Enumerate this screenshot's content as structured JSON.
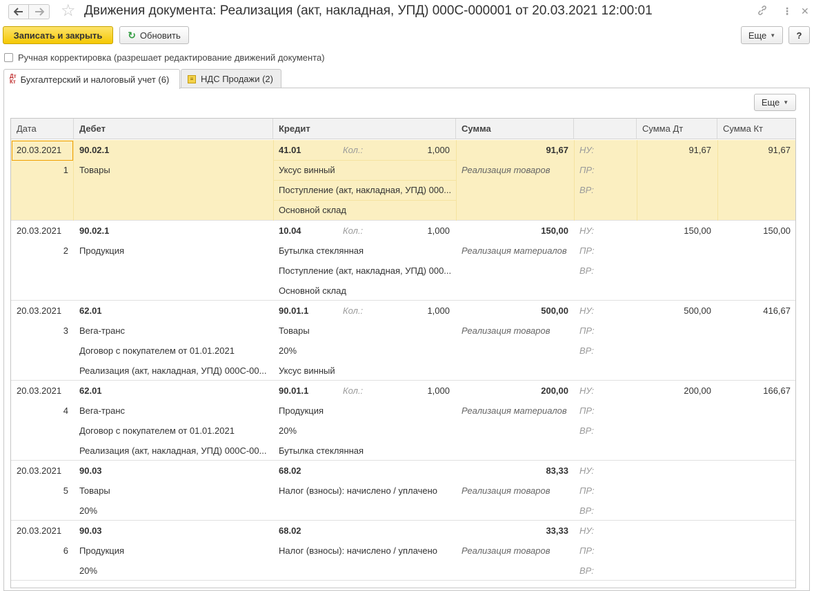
{
  "window": {
    "title": "Движения документа: Реализация (акт, накладная, УПД) 000С-000001 от 20.03.2021 12:00:01",
    "icons": {
      "back": "arrow-left-icon",
      "forward": "arrow-right-icon",
      "favorite": "star-icon",
      "link": "link-icon",
      "menu": "kebab-icon",
      "close": "close-icon"
    }
  },
  "toolbar": {
    "save_close_label": "Записать и закрыть",
    "refresh_label": "Обновить",
    "more_label": "Еще",
    "help_label": "?"
  },
  "manual_correction": {
    "label": "Ручная корректировка (разрешает редактирование движений документа)",
    "checked": false
  },
  "tabs": [
    {
      "label": "Бухгалтерский и налоговый учет (6)",
      "icon": "dt-kt-icon",
      "active": true
    },
    {
      "label": "НДС Продажи (2)",
      "icon": "register-icon",
      "active": false
    }
  ],
  "panel": {
    "more_label": "Еще"
  },
  "table": {
    "columns": [
      "Дата",
      "Дебет",
      "Кредит",
      "Сумма",
      "",
      "Сумма Дт",
      "Сумма Кт"
    ],
    "qty_label": "Кол.:",
    "tax_labels": [
      "НУ:",
      "ПР:",
      "ВР:"
    ],
    "rows": [
      {
        "date": "20.03.2021",
        "num": "1",
        "debit": [
          "90.02.1",
          "Товары",
          "",
          ""
        ],
        "credit": [
          "41.01",
          "Уксус винный",
          "Поступление (акт, накладная, УПД) 000...",
          "Основной склад"
        ],
        "qty": "1,000",
        "sum": "91,67",
        "content": "Реализация товаров",
        "sum_dt": "91,67",
        "sum_kt": "91,67"
      },
      {
        "date": "20.03.2021",
        "num": "2",
        "debit": [
          "90.02.1",
          "Продукция",
          "",
          ""
        ],
        "credit": [
          "10.04",
          "Бутылка стеклянная",
          "Поступление (акт, накладная, УПД) 000...",
          "Основной склад"
        ],
        "qty": "1,000",
        "sum": "150,00",
        "content": "Реализация материалов",
        "sum_dt": "150,00",
        "sum_kt": "150,00"
      },
      {
        "date": "20.03.2021",
        "num": "3",
        "debit": [
          "62.01",
          "Вега-транс",
          "Договор с покупателем от 01.01.2021",
          "Реализация (акт, накладная, УПД) 000С-00..."
        ],
        "credit": [
          "90.01.1",
          "Товары",
          "20%",
          "Уксус винный"
        ],
        "qty": "1,000",
        "sum": "500,00",
        "content": "Реализация товаров",
        "sum_dt": "500,00",
        "sum_kt": "416,67"
      },
      {
        "date": "20.03.2021",
        "num": "4",
        "debit": [
          "62.01",
          "Вега-транс",
          "Договор с покупателем от 01.01.2021",
          "Реализация (акт, накладная, УПД) 000С-00..."
        ],
        "credit": [
          "90.01.1",
          "Продукция",
          "20%",
          "Бутылка стеклянная"
        ],
        "qty": "1,000",
        "sum": "200,00",
        "content": "Реализация материалов",
        "sum_dt": "200,00",
        "sum_kt": "166,67"
      },
      {
        "date": "20.03.2021",
        "num": "5",
        "debit": [
          "90.03",
          "Товары",
          "20%",
          ""
        ],
        "credit": [
          "68.02",
          "Налог (взносы): начислено / уплачено",
          "",
          ""
        ],
        "qty": "",
        "sum": "83,33",
        "content": "Реализация товаров",
        "sum_dt": "",
        "sum_kt": ""
      },
      {
        "date": "20.03.2021",
        "num": "6",
        "debit": [
          "90.03",
          "Продукция",
          "20%",
          ""
        ],
        "credit": [
          "68.02",
          "Налог (взносы): начислено / уплачено",
          "",
          ""
        ],
        "qty": "",
        "sum": "33,33",
        "content": "Реализация товаров",
        "sum_dt": "",
        "sum_kt": ""
      }
    ]
  },
  "colors": {
    "accent": "#f5c804",
    "selected_row": "#fbefc1",
    "selected_cell_border": "#f0a000"
  }
}
